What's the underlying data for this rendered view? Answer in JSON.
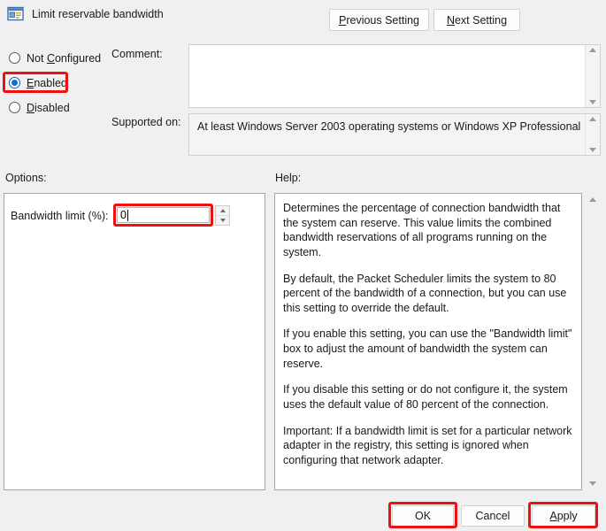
{
  "window": {
    "title": "Limit reservable bandwidth",
    "icon": "policy-setting-icon"
  },
  "navigation": {
    "previous_label": "Previous Setting",
    "previous_accel": "P",
    "next_label": "Next Setting",
    "next_accel": "N"
  },
  "state_options": [
    {
      "label": "Not Configured",
      "accel_prefix": "Not ",
      "accel": "C",
      "accel_suffix": "onfigured",
      "selected": false
    },
    {
      "label": "Enabled",
      "accel_prefix": "",
      "accel": "E",
      "accel_suffix": "nabled",
      "selected": true
    },
    {
      "label": "Disabled",
      "accel_prefix": "",
      "accel": "D",
      "accel_suffix": "isabled",
      "selected": false
    }
  ],
  "comment": {
    "label": "Comment:",
    "value": "",
    "placeholder": ""
  },
  "supported_on": {
    "label": "Supported on:",
    "value": "At least Windows Server 2003 operating systems or Windows XP Professional"
  },
  "options": {
    "section_label": "Options:",
    "bandwidth": {
      "label": "Bandwidth limit (%):",
      "value": "0",
      "spinner_up": "spinner-up-icon",
      "spinner_down": "spinner-down-icon"
    }
  },
  "help": {
    "section_label": "Help:",
    "paragraphs": [
      "Determines the percentage of connection bandwidth that the system can reserve. This value limits the combined bandwidth reservations of all programs running on the system.",
      "By default, the Packet Scheduler limits the system to 80 percent of the bandwidth of a connection, but you can use this setting to override the default.",
      "If you enable this setting, you can use the \"Bandwidth limit\" box to adjust the amount of bandwidth the system can reserve.",
      "If you disable this setting or do not configure it, the system uses the default value of 80 percent of the connection.",
      "Important: If a bandwidth limit is set for a particular network adapter in the registry, this setting is ignored when configuring that network adapter."
    ]
  },
  "footer": {
    "ok_label": "OK",
    "cancel_label": "Cancel",
    "apply_label": "Apply",
    "apply_accel": "A"
  },
  "highlights": {
    "color": "#ee1111",
    "targets": [
      "enabled-radio",
      "bandwidth-input",
      "ok-button",
      "apply-button"
    ]
  }
}
